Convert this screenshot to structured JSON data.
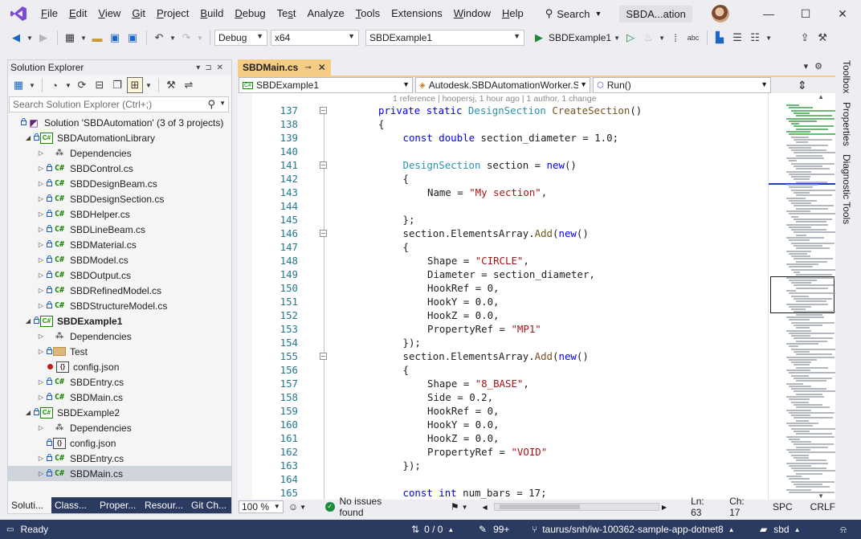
{
  "menu": [
    "File",
    "Edit",
    "View",
    "Git",
    "Project",
    "Build",
    "Debug",
    "Test",
    "Analyze",
    "Tools",
    "Extensions",
    "Window",
    "Help"
  ],
  "menu_underline": [
    "F",
    "E",
    "V",
    "G",
    "P",
    "B",
    "D",
    "s",
    "N",
    "T",
    "X",
    "W",
    "H"
  ],
  "search": {
    "label": "Search"
  },
  "solution_badge": "SBDA...ation",
  "window_controls": {
    "minimize": "—",
    "maximize": "☐",
    "close": "✕"
  },
  "toolbar": {
    "config": "Debug",
    "platform": "x64",
    "startup_project": "SBDExample1",
    "run_label": "SBDExample1"
  },
  "solution_explorer": {
    "title": "Solution Explorer",
    "search_placeholder": "Search Solution Explorer (Ctrl+;)",
    "items": [
      {
        "label": "Solution 'SBDAutomation' (3 of 3 projects)",
        "indent": 0,
        "icon": "sln",
        "exp": "",
        "lock": true,
        "bold": false
      },
      {
        "label": "SBDAutomationLibrary",
        "indent": 1,
        "icon": "proj",
        "exp": "◢",
        "lock": true,
        "bold": false
      },
      {
        "label": "Dependencies",
        "indent": 2,
        "icon": "dep",
        "exp": "▷",
        "lock": false,
        "bold": false
      },
      {
        "label": "SBDControl.cs",
        "indent": 2,
        "icon": "cs",
        "exp": "▷",
        "lock": true,
        "bold": false
      },
      {
        "label": "SBDDesignBeam.cs",
        "indent": 2,
        "icon": "cs",
        "exp": "▷",
        "lock": true,
        "bold": false
      },
      {
        "label": "SBDDesignSection.cs",
        "indent": 2,
        "icon": "cs",
        "exp": "▷",
        "lock": true,
        "bold": false
      },
      {
        "label": "SBDHelper.cs",
        "indent": 2,
        "icon": "cs",
        "exp": "▷",
        "lock": true,
        "bold": false
      },
      {
        "label": "SBDLineBeam.cs",
        "indent": 2,
        "icon": "cs",
        "exp": "▷",
        "lock": true,
        "bold": false
      },
      {
        "label": "SBDMaterial.cs",
        "indent": 2,
        "icon": "cs",
        "exp": "▷",
        "lock": true,
        "bold": false
      },
      {
        "label": "SBDModel.cs",
        "indent": 2,
        "icon": "cs",
        "exp": "▷",
        "lock": true,
        "bold": false
      },
      {
        "label": "SBDOutput.cs",
        "indent": 2,
        "icon": "cs",
        "exp": "▷",
        "lock": true,
        "bold": false
      },
      {
        "label": "SBDRefinedModel.cs",
        "indent": 2,
        "icon": "cs",
        "exp": "▷",
        "lock": true,
        "bold": false
      },
      {
        "label": "SBDStructureModel.cs",
        "indent": 2,
        "icon": "cs",
        "exp": "▷",
        "lock": true,
        "bold": false
      },
      {
        "label": "SBDExample1",
        "indent": 1,
        "icon": "proj",
        "exp": "◢",
        "lock": true,
        "bold": true
      },
      {
        "label": "Dependencies",
        "indent": 2,
        "icon": "dep",
        "exp": "▷",
        "lock": false,
        "bold": false
      },
      {
        "label": "Test",
        "indent": 2,
        "icon": "folder",
        "exp": "▷",
        "lock": true,
        "bold": false
      },
      {
        "label": "config.json",
        "indent": 2,
        "icon": "json",
        "exp": "",
        "lock": false,
        "bold": false,
        "red": true
      },
      {
        "label": "SBDEntry.cs",
        "indent": 2,
        "icon": "cs",
        "exp": "▷",
        "lock": true,
        "bold": false
      },
      {
        "label": "SBDMain.cs",
        "indent": 2,
        "icon": "cs",
        "exp": "▷",
        "lock": true,
        "bold": false
      },
      {
        "label": "SBDExample2",
        "indent": 1,
        "icon": "proj",
        "exp": "◢",
        "lock": true,
        "bold": false
      },
      {
        "label": "Dependencies",
        "indent": 2,
        "icon": "dep",
        "exp": "▷",
        "lock": false,
        "bold": false
      },
      {
        "label": "config.json",
        "indent": 2,
        "icon": "json",
        "exp": "",
        "lock": true,
        "bold": false
      },
      {
        "label": "SBDEntry.cs",
        "indent": 2,
        "icon": "cs",
        "exp": "▷",
        "lock": true,
        "bold": false
      },
      {
        "label": "SBDMain.cs",
        "indent": 2,
        "icon": "cs",
        "exp": "▷",
        "lock": true,
        "bold": false,
        "selected": true
      }
    ],
    "bottom_tabs": [
      "Soluti...",
      "Class...",
      "Proper...",
      "Resour...",
      "Git Ch..."
    ]
  },
  "editor": {
    "tab_title": "SBDMain.cs",
    "nav": {
      "project": "SBDExample1",
      "class": "Autodesk.SBDAutomationWorker.S",
      "member": "Run()"
    },
    "code_lens": "1 reference | hoopersj, 1 hour ago | 1 author, 1 change",
    "lines": [
      {
        "n": "137",
        "indent": 2,
        "fold": true,
        "tokens": [
          [
            "kw",
            "private "
          ],
          [
            "kw",
            "static "
          ],
          [
            "ty",
            "DesignSection "
          ],
          [
            "fn",
            "CreateSection"
          ],
          [
            "pl",
            "()"
          ]
        ]
      },
      {
        "n": "138",
        "indent": 2,
        "fold": false,
        "tokens": [
          [
            "pl",
            "{"
          ]
        ]
      },
      {
        "n": "139",
        "indent": 3,
        "fold": false,
        "tokens": [
          [
            "kw",
            "const "
          ],
          [
            "kw",
            "double "
          ],
          [
            "pl",
            "section_diameter = 1.0;"
          ]
        ]
      },
      {
        "n": "140",
        "indent": 0,
        "fold": false,
        "tokens": []
      },
      {
        "n": "141",
        "indent": 3,
        "fold": true,
        "tokens": [
          [
            "ty",
            "DesignSection "
          ],
          [
            "pl",
            "section = "
          ],
          [
            "kw",
            "new"
          ],
          [
            "pl",
            "()"
          ]
        ]
      },
      {
        "n": "142",
        "indent": 3,
        "fold": false,
        "tokens": [
          [
            "pl",
            "{"
          ]
        ]
      },
      {
        "n": "143",
        "indent": 4,
        "fold": false,
        "tokens": [
          [
            "pl",
            "Name = "
          ],
          [
            "st",
            "\"My section\""
          ],
          [
            "pl",
            ","
          ]
        ]
      },
      {
        "n": "144",
        "indent": 0,
        "fold": false,
        "tokens": []
      },
      {
        "n": "145",
        "indent": 3,
        "fold": false,
        "tokens": [
          [
            "pl",
            "};"
          ]
        ]
      },
      {
        "n": "146",
        "indent": 3,
        "fold": true,
        "tokens": [
          [
            "pl",
            "section.ElementsArray."
          ],
          [
            "fn",
            "Add"
          ],
          [
            "pl",
            "("
          ],
          [
            "kw",
            "new"
          ],
          [
            "pl",
            "()"
          ]
        ]
      },
      {
        "n": "147",
        "indent": 3,
        "fold": false,
        "tokens": [
          [
            "pl",
            "{"
          ]
        ]
      },
      {
        "n": "148",
        "indent": 4,
        "fold": false,
        "tokens": [
          [
            "pl",
            "Shape = "
          ],
          [
            "st",
            "\"CIRCLE\""
          ],
          [
            "pl",
            ","
          ]
        ]
      },
      {
        "n": "149",
        "indent": 4,
        "fold": false,
        "tokens": [
          [
            "pl",
            "Diameter = section_diameter,"
          ]
        ]
      },
      {
        "n": "150",
        "indent": 4,
        "fold": false,
        "tokens": [
          [
            "pl",
            "HookRef = 0,"
          ]
        ]
      },
      {
        "n": "151",
        "indent": 4,
        "fold": false,
        "tokens": [
          [
            "pl",
            "HookY = 0.0,"
          ]
        ]
      },
      {
        "n": "152",
        "indent": 4,
        "fold": false,
        "tokens": [
          [
            "pl",
            "HookZ = 0.0,"
          ]
        ]
      },
      {
        "n": "153",
        "indent": 4,
        "fold": false,
        "tokens": [
          [
            "pl",
            "PropertyRef = "
          ],
          [
            "st",
            "\"MP1\""
          ]
        ]
      },
      {
        "n": "154",
        "indent": 3,
        "fold": false,
        "tokens": [
          [
            "pl",
            "});"
          ]
        ]
      },
      {
        "n": "155",
        "indent": 3,
        "fold": true,
        "tokens": [
          [
            "pl",
            "section.ElementsArray."
          ],
          [
            "fn",
            "Add"
          ],
          [
            "pl",
            "("
          ],
          [
            "kw",
            "new"
          ],
          [
            "pl",
            "()"
          ]
        ]
      },
      {
        "n": "156",
        "indent": 3,
        "fold": false,
        "tokens": [
          [
            "pl",
            "{"
          ]
        ]
      },
      {
        "n": "157",
        "indent": 4,
        "fold": false,
        "tokens": [
          [
            "pl",
            "Shape = "
          ],
          [
            "st",
            "\"8_BASE\""
          ],
          [
            "pl",
            ","
          ]
        ]
      },
      {
        "n": "158",
        "indent": 4,
        "fold": false,
        "tokens": [
          [
            "pl",
            "Side = 0.2,"
          ]
        ]
      },
      {
        "n": "159",
        "indent": 4,
        "fold": false,
        "tokens": [
          [
            "pl",
            "HookRef = 0,"
          ]
        ]
      },
      {
        "n": "160",
        "indent": 4,
        "fold": false,
        "tokens": [
          [
            "pl",
            "HookY = 0.0,"
          ]
        ]
      },
      {
        "n": "161",
        "indent": 4,
        "fold": false,
        "tokens": [
          [
            "pl",
            "HookZ = 0.0,"
          ]
        ]
      },
      {
        "n": "162",
        "indent": 4,
        "fold": false,
        "tokens": [
          [
            "pl",
            "PropertyRef = "
          ],
          [
            "st",
            "\"VOID\""
          ]
        ]
      },
      {
        "n": "163",
        "indent": 3,
        "fold": false,
        "tokens": [
          [
            "pl",
            "});"
          ]
        ]
      },
      {
        "n": "164",
        "indent": 0,
        "fold": false,
        "tokens": []
      },
      {
        "n": "165",
        "indent": 3,
        "fold": false,
        "tokens": [
          [
            "kw",
            "const "
          ],
          [
            "kw",
            "int "
          ],
          [
            "pl",
            "num_bars = 17;"
          ]
        ]
      }
    ],
    "status": {
      "zoom": "100 %",
      "issues": "No issues found",
      "ln": "Ln: 63",
      "ch": "Ch: 17",
      "spc": "SPC",
      "eol": "CRLF"
    }
  },
  "right_tabs": [
    "Toolbox",
    "Properties",
    "Diagnostic Tools"
  ],
  "statusbar": {
    "ready": "Ready",
    "changes": "0 / 0",
    "commits": "99+",
    "branch": "taurus/snh/iw-100362-sample-app-dotnet8",
    "repo": "sbd"
  },
  "colors": {
    "accent_tab": "#f5cc84",
    "statusbar": "#2b3a61",
    "keyword": "#0000ff",
    "type": "#2b91af",
    "string": "#a31515",
    "method": "#74531f"
  }
}
